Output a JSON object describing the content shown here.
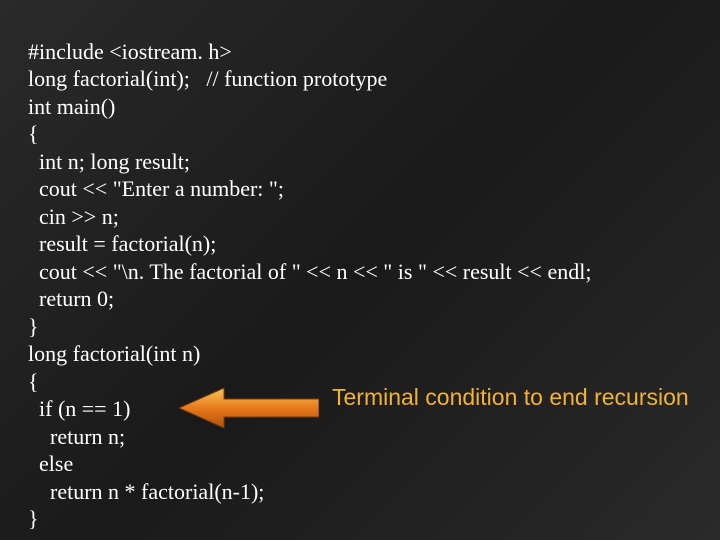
{
  "code": {
    "l1": "#include <iostream. h>",
    "l2": "long factorial(int);   // function prototype",
    "l3": "int main()",
    "l4": "{",
    "l5": "  int n; long result;",
    "l6": "  cout << \"Enter a number: \";",
    "l7": "  cin >> n;",
    "l8": "  result = factorial(n);",
    "l9": "  cout << \"\\n. The factorial of \" << n << \" is \" << result << endl;",
    "l10": "  return 0;",
    "l11": "}",
    "l12": "long factorial(int n)",
    "l13": "{",
    "l14": "  if (n == 1)",
    "l15": "    return n;",
    "l16": "  else",
    "l17": "    return n * factorial(n-1);",
    "l18": "}"
  },
  "annotation": {
    "text": "Terminal condition to end recursion"
  }
}
